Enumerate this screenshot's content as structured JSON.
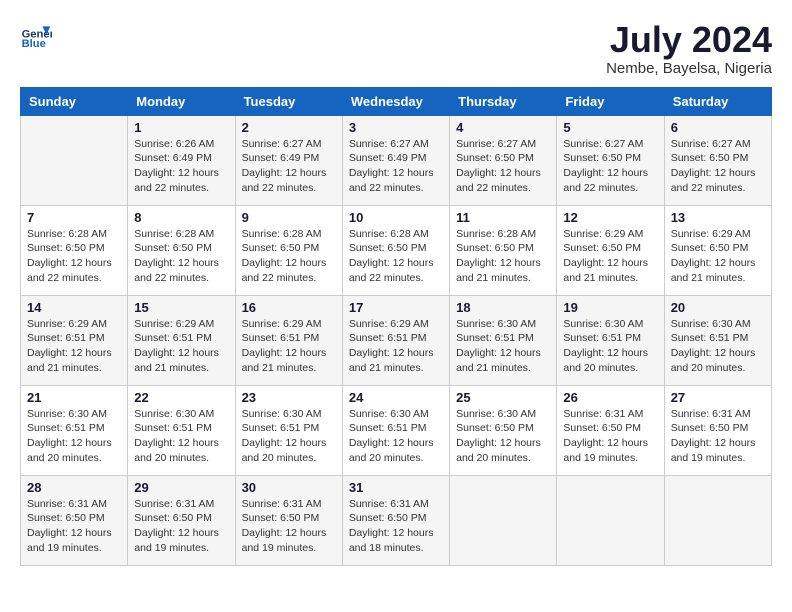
{
  "header": {
    "logo_line1": "General",
    "logo_line2": "Blue",
    "month_year": "July 2024",
    "location": "Nembe, Bayelsa, Nigeria"
  },
  "days_of_week": [
    "Sunday",
    "Monday",
    "Tuesday",
    "Wednesday",
    "Thursday",
    "Friday",
    "Saturday"
  ],
  "weeks": [
    [
      {
        "day": "",
        "info": ""
      },
      {
        "day": "1",
        "info": "Sunrise: 6:26 AM\nSunset: 6:49 PM\nDaylight: 12 hours\nand 22 minutes."
      },
      {
        "day": "2",
        "info": "Sunrise: 6:27 AM\nSunset: 6:49 PM\nDaylight: 12 hours\nand 22 minutes."
      },
      {
        "day": "3",
        "info": "Sunrise: 6:27 AM\nSunset: 6:49 PM\nDaylight: 12 hours\nand 22 minutes."
      },
      {
        "day": "4",
        "info": "Sunrise: 6:27 AM\nSunset: 6:50 PM\nDaylight: 12 hours\nand 22 minutes."
      },
      {
        "day": "5",
        "info": "Sunrise: 6:27 AM\nSunset: 6:50 PM\nDaylight: 12 hours\nand 22 minutes."
      },
      {
        "day": "6",
        "info": "Sunrise: 6:27 AM\nSunset: 6:50 PM\nDaylight: 12 hours\nand 22 minutes."
      }
    ],
    [
      {
        "day": "7",
        "info": "Sunrise: 6:28 AM\nSunset: 6:50 PM\nDaylight: 12 hours\nand 22 minutes."
      },
      {
        "day": "8",
        "info": "Sunrise: 6:28 AM\nSunset: 6:50 PM\nDaylight: 12 hours\nand 22 minutes."
      },
      {
        "day": "9",
        "info": "Sunrise: 6:28 AM\nSunset: 6:50 PM\nDaylight: 12 hours\nand 22 minutes."
      },
      {
        "day": "10",
        "info": "Sunrise: 6:28 AM\nSunset: 6:50 PM\nDaylight: 12 hours\nand 22 minutes."
      },
      {
        "day": "11",
        "info": "Sunrise: 6:28 AM\nSunset: 6:50 PM\nDaylight: 12 hours\nand 21 minutes."
      },
      {
        "day": "12",
        "info": "Sunrise: 6:29 AM\nSunset: 6:50 PM\nDaylight: 12 hours\nand 21 minutes."
      },
      {
        "day": "13",
        "info": "Sunrise: 6:29 AM\nSunset: 6:50 PM\nDaylight: 12 hours\nand 21 minutes."
      }
    ],
    [
      {
        "day": "14",
        "info": "Sunrise: 6:29 AM\nSunset: 6:51 PM\nDaylight: 12 hours\nand 21 minutes."
      },
      {
        "day": "15",
        "info": "Sunrise: 6:29 AM\nSunset: 6:51 PM\nDaylight: 12 hours\nand 21 minutes."
      },
      {
        "day": "16",
        "info": "Sunrise: 6:29 AM\nSunset: 6:51 PM\nDaylight: 12 hours\nand 21 minutes."
      },
      {
        "day": "17",
        "info": "Sunrise: 6:29 AM\nSunset: 6:51 PM\nDaylight: 12 hours\nand 21 minutes."
      },
      {
        "day": "18",
        "info": "Sunrise: 6:30 AM\nSunset: 6:51 PM\nDaylight: 12 hours\nand 21 minutes."
      },
      {
        "day": "19",
        "info": "Sunrise: 6:30 AM\nSunset: 6:51 PM\nDaylight: 12 hours\nand 20 minutes."
      },
      {
        "day": "20",
        "info": "Sunrise: 6:30 AM\nSunset: 6:51 PM\nDaylight: 12 hours\nand 20 minutes."
      }
    ],
    [
      {
        "day": "21",
        "info": "Sunrise: 6:30 AM\nSunset: 6:51 PM\nDaylight: 12 hours\nand 20 minutes."
      },
      {
        "day": "22",
        "info": "Sunrise: 6:30 AM\nSunset: 6:51 PM\nDaylight: 12 hours\nand 20 minutes."
      },
      {
        "day": "23",
        "info": "Sunrise: 6:30 AM\nSunset: 6:51 PM\nDaylight: 12 hours\nand 20 minutes."
      },
      {
        "day": "24",
        "info": "Sunrise: 6:30 AM\nSunset: 6:51 PM\nDaylight: 12 hours\nand 20 minutes."
      },
      {
        "day": "25",
        "info": "Sunrise: 6:30 AM\nSunset: 6:50 PM\nDaylight: 12 hours\nand 20 minutes."
      },
      {
        "day": "26",
        "info": "Sunrise: 6:31 AM\nSunset: 6:50 PM\nDaylight: 12 hours\nand 19 minutes."
      },
      {
        "day": "27",
        "info": "Sunrise: 6:31 AM\nSunset: 6:50 PM\nDaylight: 12 hours\nand 19 minutes."
      }
    ],
    [
      {
        "day": "28",
        "info": "Sunrise: 6:31 AM\nSunset: 6:50 PM\nDaylight: 12 hours\nand 19 minutes."
      },
      {
        "day": "29",
        "info": "Sunrise: 6:31 AM\nSunset: 6:50 PM\nDaylight: 12 hours\nand 19 minutes."
      },
      {
        "day": "30",
        "info": "Sunrise: 6:31 AM\nSunset: 6:50 PM\nDaylight: 12 hours\nand 19 minutes."
      },
      {
        "day": "31",
        "info": "Sunrise: 6:31 AM\nSunset: 6:50 PM\nDaylight: 12 hours\nand 18 minutes."
      },
      {
        "day": "",
        "info": ""
      },
      {
        "day": "",
        "info": ""
      },
      {
        "day": "",
        "info": ""
      }
    ]
  ]
}
